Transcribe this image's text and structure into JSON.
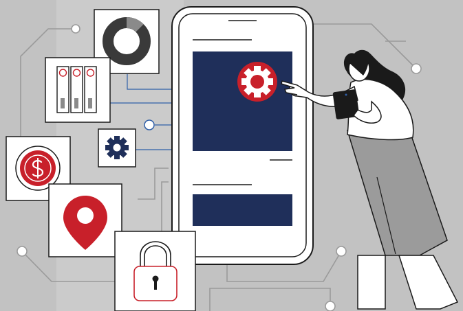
{
  "colors": {
    "background": "#c2c2c2",
    "background_band": "#cbcbcb",
    "circuit_line": "#9a9a9a",
    "connector_line": "#2f5fa8",
    "card": "#ffffff",
    "navy": "#1f2f5a",
    "red": "#c8202a",
    "outline": "#1a1a1a",
    "pants_gray": "#9b9b9b",
    "gray_box": "#7a7a7a"
  },
  "icons": [
    "donut-chart-icon",
    "server-rack-icon",
    "gear-icon",
    "dollar-coin-icon",
    "map-pin-icon",
    "padlock-icon",
    "phone-gear-icon",
    "tablet-icon"
  ],
  "donut_chart": {
    "filled_fraction": 0.875
  }
}
